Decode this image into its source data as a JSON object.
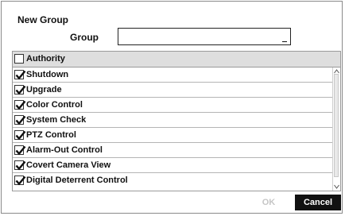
{
  "dialog": {
    "title": "New Group",
    "group_label": "Group",
    "group_value": ""
  },
  "permissions": {
    "header_label": "Authority",
    "header_checked": false,
    "items": [
      {
        "label": "Shutdown",
        "checked": true
      },
      {
        "label": "Upgrade",
        "checked": true
      },
      {
        "label": "Color Control",
        "checked": true
      },
      {
        "label": "System Check",
        "checked": true
      },
      {
        "label": "PTZ Control",
        "checked": true
      },
      {
        "label": "Alarm-Out Control",
        "checked": true
      },
      {
        "label": "Covert Camera View",
        "checked": true
      },
      {
        "label": "Digital Deterrent Control",
        "checked": true
      }
    ]
  },
  "buttons": {
    "ok_label": "OK",
    "ok_enabled": false,
    "cancel_label": "Cancel"
  },
  "icons": {
    "check": "checkmark-icon",
    "scroll_up": "scroll-up-arrow-icon",
    "scroll_down": "scroll-down-arrow-icon"
  }
}
